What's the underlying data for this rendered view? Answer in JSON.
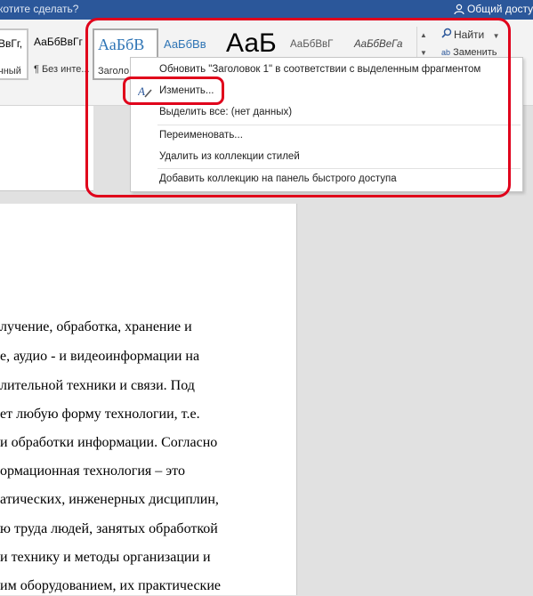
{
  "titlebar": {
    "tell_me": "котите сделать?",
    "share": "Общий досту",
    "bg_color": "#2b579a"
  },
  "ribbon": {
    "styles": [
      {
        "sample": "ВвГг,",
        "name": "чный"
      },
      {
        "sample": "АаБбВвГг",
        "name": "¶ Без инте..."
      },
      {
        "sample": "АаБбВ",
        "name": "Заголо"
      },
      {
        "sample": "АаБбВв",
        "name": ""
      },
      {
        "sample": "АаБ",
        "name": ""
      },
      {
        "sample": "АаБбВвГ",
        "name": ""
      },
      {
        "sample": "АаБбВеГа",
        "name": ""
      }
    ],
    "find": "Найти",
    "replace": "Заменить"
  },
  "context_menu": {
    "items": [
      {
        "label": "Обновить \"Заголовок 1\" в соответствии с выделенным фрагментом"
      },
      {
        "label": "Изменить..."
      },
      {
        "label": "Выделить все: (нет данных)"
      },
      {
        "label": "Переименовать..."
      },
      {
        "label": "Удалить из коллекции стилей"
      },
      {
        "label": "Добавить коллекцию на панель быстрого доступа"
      }
    ]
  },
  "document": {
    "lines": [
      {
        "text": "лучение,   обработка,   хранение   и"
      },
      {
        "text": "е, аудио - и видеоинформации на"
      },
      {
        "text": "лительной   техники   и   связи.   Под"
      },
      {
        "text": "ет  любую  форму  технологии,  т.е."
      },
      {
        "text": "и обработки информации. Согласно"
      },
      {
        "text": "ормационная   технология   –   это"
      },
      {
        "text": "атических, инженерных дисциплин,"
      },
      {
        "text": "ю труда людей, занятых обработкой"
      },
      {
        "text": "и технику и методы организации и"
      },
      {
        "text": "им оборудованием, их практические"
      }
    ]
  },
  "annotation_color": "#e0001b"
}
